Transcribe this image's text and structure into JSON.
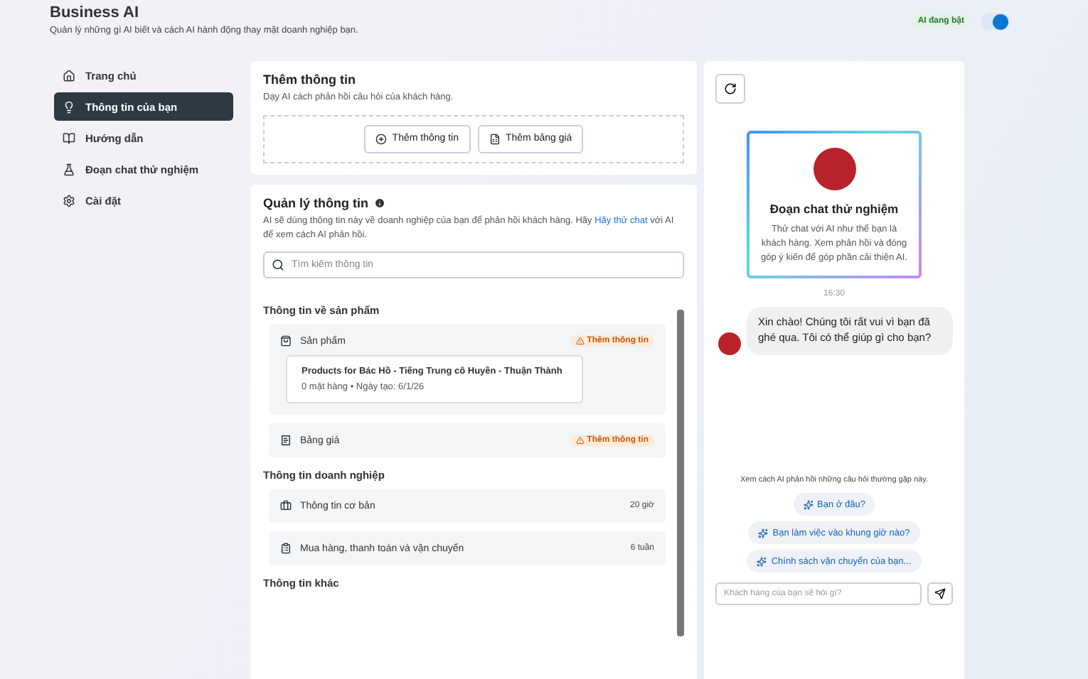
{
  "header": {
    "title": "Business AI",
    "subtitle": "Quản lý những gì AI biết và cách AI hành động thay mặt doanh nghiệp bạn.",
    "status_badge": "AI đang bật",
    "toggle": {
      "on": true
    }
  },
  "sidebar": {
    "items": [
      {
        "label": "Trang chủ",
        "selected": false
      },
      {
        "label": "Thông tin của bạn",
        "selected": true
      },
      {
        "label": "Hướng dẫn",
        "selected": false
      },
      {
        "label": "Đoạn chat thử nghiệm",
        "selected": false
      },
      {
        "label": "Cài đặt",
        "selected": false
      }
    ]
  },
  "add_info": {
    "title": "Thêm thông tin",
    "description": "Dạy AI cách phản hồi câu hỏi của khách hàng.",
    "buttons": [
      "Thêm thông tin",
      "Thêm bảng giá"
    ]
  },
  "manage": {
    "title": "Quản lý thông tin",
    "description_before": "AI sẽ dùng thông tin này về doanh nghiệp của bạn để phản hồi khách hàng. Hãy",
    "description_link": "Hãy thử chat",
    "description_after": "với AI để xem cách AI phản hồi.",
    "search_placeholder": "Tìm kiếm thông tin",
    "sections": [
      {
        "title": "Thông tin về sản phẩm",
        "items": [
          {
            "kind": "missing",
            "label": "Sản phẩm",
            "badge": "Thêm thông tin",
            "card": {
              "title": "Products for Bác Hồ - Tiếng Trung cô Huyền - Thuận Thành",
              "subtitle": "0 mặt hàng • Ngày tạo: 6/1/26"
            }
          },
          {
            "kind": "missing",
            "label": "Bảng giá",
            "badge": "Thêm thông tin"
          }
        ]
      },
      {
        "title": "Thông tin doanh nghiệp",
        "items": [
          {
            "kind": "updated",
            "label": "Thông tin cơ bản",
            "meta": "20 giờ"
          },
          {
            "kind": "updated",
            "label": "Mua hàng, thanh toán và vận chuyển",
            "meta": "6 tuần"
          }
        ]
      },
      {
        "title": "Thông tin khác"
      }
    ]
  },
  "chat": {
    "card_title": "Đoạn chat thử nghiệm",
    "card_description": "Thử chat với AI như thể bạn là khách hàng. Xem phản hồi và đóng góp ý kiến để góp phần cải thiện AI.",
    "time": "16:30",
    "message": "Xin chào! Chúng tôi rất vui vì bạn đã ghé qua. Tôi có thể giúp gì cho bạn?",
    "suggestions_hint": "Xem cách AI phản hồi những câu hỏi thường gặp này.",
    "suggestions": [
      "Bạn ở đâu?",
      "Bạn làm việc vào khung giờ nào?",
      "Chính sách vận chuyển của bạn..."
    ],
    "input_placeholder": "Khách hàng của bạn sẽ hỏi gì?"
  }
}
